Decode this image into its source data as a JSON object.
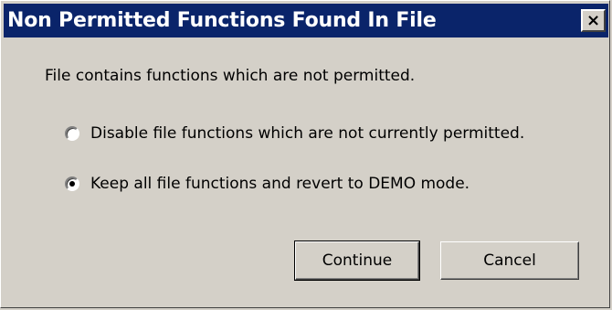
{
  "dialog": {
    "title": "Non Permitted Functions Found In File",
    "close_label": "×",
    "message": "File contains functions which are not permitted.",
    "options": [
      {
        "label": "Disable file functions which are not currently permitted.",
        "selected": false
      },
      {
        "label": "Keep all file functions and revert to DEMO mode.",
        "selected": true
      }
    ],
    "buttons": {
      "continue_label": "Continue",
      "cancel_label": "Cancel"
    }
  },
  "colors": {
    "titlebar": "#0a246a",
    "face": "#d4d0c8",
    "title_text": "#ffffff"
  },
  "icons": {
    "close": "close-icon",
    "radio": "radio-button"
  }
}
